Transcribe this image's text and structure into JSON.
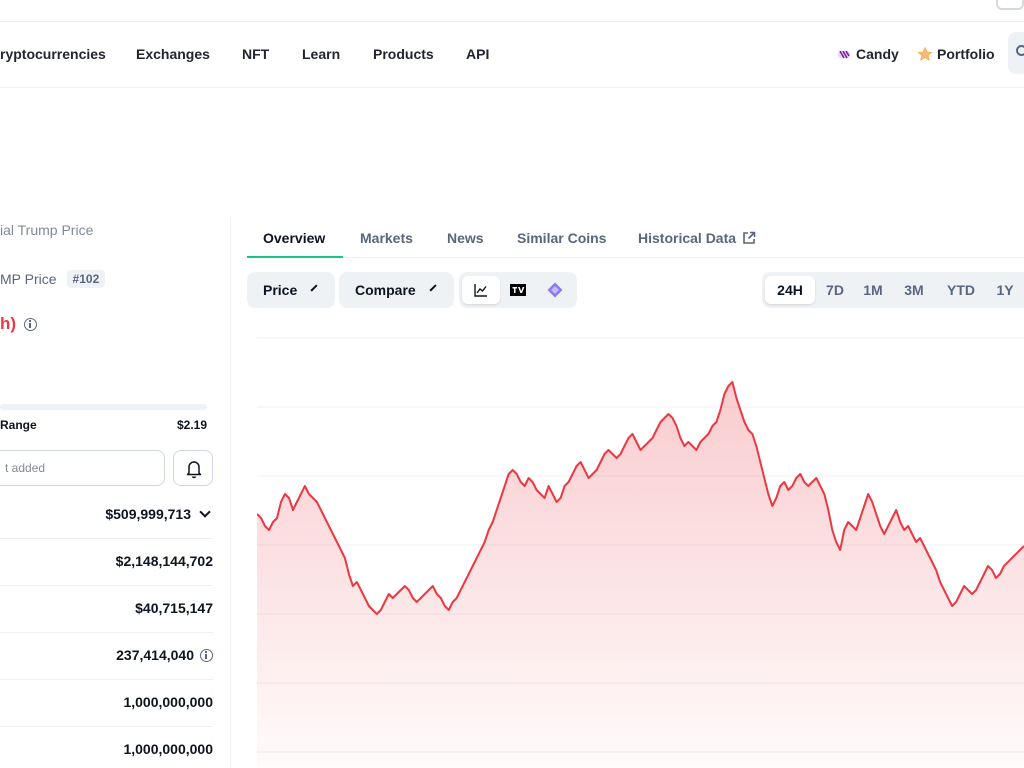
{
  "nav": {
    "items": [
      "ryptocurrencies",
      "Exchanges",
      "NFT",
      "Learn",
      "Products",
      "API"
    ],
    "candy": "Candy",
    "portfolio": "Portfolio"
  },
  "coin": {
    "breadcrumb": "ial Trump Price",
    "name": "MP Price",
    "rank": "#102",
    "change_label": "h)"
  },
  "range_label": "Range",
  "range_high": "$2.19",
  "alert_placeholder": "t added",
  "stats": [
    {
      "value": "$509,999,713",
      "expandable": true
    },
    {
      "value": "$2,148,144,702"
    },
    {
      "value": "$40,715,147"
    },
    {
      "value": "237,414,040",
      "info": true
    },
    {
      "value": "1,000,000,000"
    },
    {
      "value": "1,000,000,000"
    }
  ],
  "tabs": [
    "Overview",
    "Markets",
    "News",
    "Similar Coins",
    "Historical Data"
  ],
  "controls": {
    "price": "Price",
    "compare": "Compare"
  },
  "ranges": [
    "24H",
    "7D",
    "1M",
    "3M",
    "YTD",
    "1Y"
  ],
  "colors": {
    "line": "#ea3943",
    "fill": "#ea3943",
    "accent": "#16c784"
  },
  "chart_data": {
    "type": "area",
    "values": [
      59,
      58,
      56,
      55,
      57,
      58,
      62,
      64,
      63,
      60,
      62,
      64,
      66,
      64,
      63,
      62,
      60,
      58,
      56,
      54,
      52,
      50,
      48,
      44,
      41,
      42,
      40,
      38,
      36,
      35,
      34,
      35,
      37,
      39,
      38,
      39,
      40,
      41,
      40,
      38,
      37,
      38,
      39,
      40,
      41,
      39,
      38,
      36,
      35,
      37,
      38,
      40,
      42,
      44,
      46,
      48,
      50,
      52,
      55,
      57,
      60,
      63,
      66,
      69,
      70,
      69,
      67,
      66,
      68,
      67,
      65,
      64,
      63,
      66,
      64,
      62,
      63,
      66,
      67,
      69,
      71,
      72,
      70,
      68,
      69,
      70,
      72,
      74,
      75,
      74,
      73,
      74,
      76,
      78,
      79,
      77,
      75,
      76,
      77,
      78,
      80,
      82,
      83,
      84,
      83,
      81,
      78,
      76,
      77,
      76,
      75,
      77,
      78,
      79,
      81,
      82,
      85,
      89,
      91,
      92,
      88,
      85,
      82,
      80,
      79,
      76,
      72,
      68,
      64,
      61,
      63,
      66,
      67,
      65,
      66,
      68,
      69,
      67,
      66,
      67,
      68,
      66,
      64,
      60,
      55,
      52,
      50,
      55,
      57,
      56,
      55,
      58,
      61,
      64,
      62,
      59,
      56,
      54,
      56,
      58,
      60,
      57,
      55,
      56,
      54,
      52,
      53,
      51,
      49,
      47,
      45,
      42,
      40,
      38,
      36,
      37,
      39,
      41,
      40,
      39,
      40,
      42,
      44,
      46,
      45,
      43,
      44,
      46,
      47,
      48,
      49,
      50,
      51
    ]
  }
}
